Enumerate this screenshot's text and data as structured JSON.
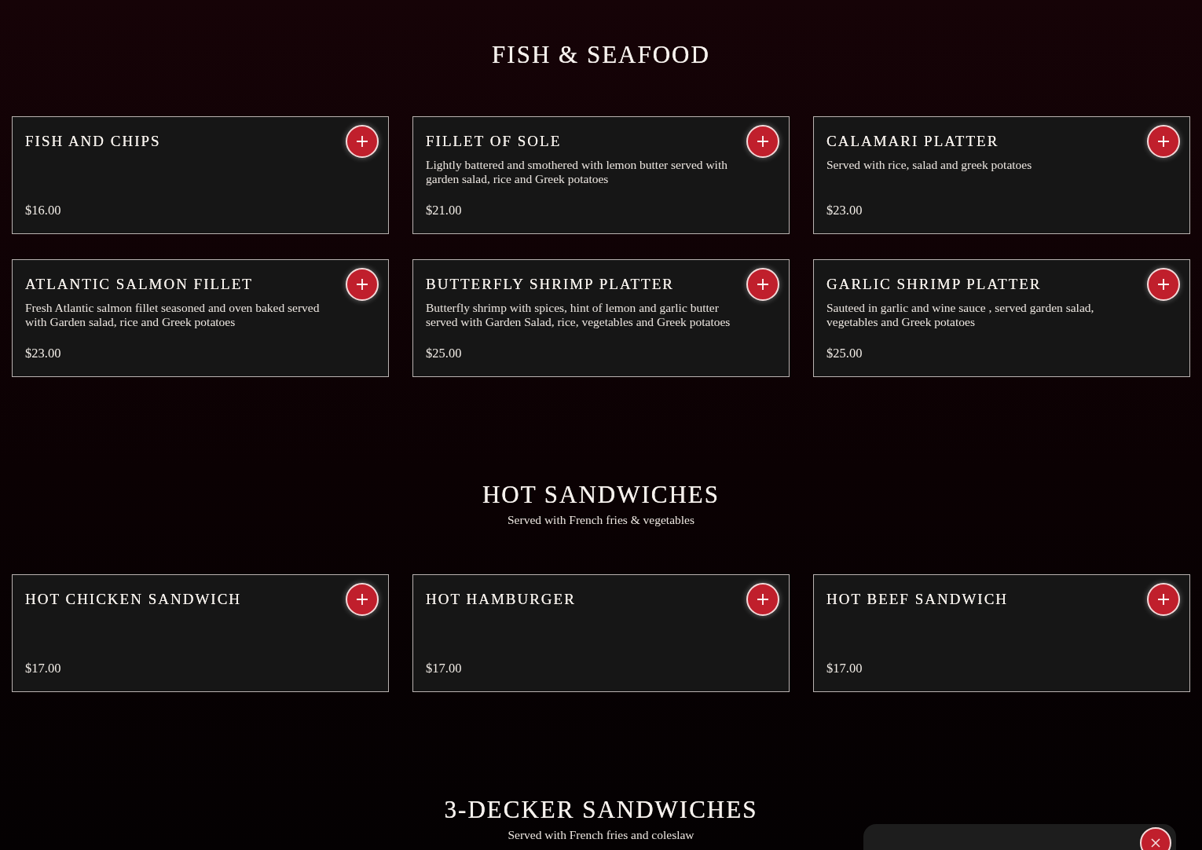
{
  "sections": [
    {
      "title": "FISH & SEAFOOD",
      "items": [
        {
          "name": "FISH AND CHIPS",
          "price": "$16.00"
        },
        {
          "name": "FILLET OF SOLE",
          "description": "Lightly battered and smothered with lemon butter served with garden salad, rice and Greek potatoes",
          "price": "$21.00"
        },
        {
          "name": "CALAMARI PLATTER",
          "description": "Served with rice, salad and greek potatoes",
          "price": "$23.00"
        },
        {
          "name": "ATLANTIC SALMON FILLET",
          "description": "Fresh Atlantic salmon fillet seasoned and oven baked served with Garden salad, rice and Greek potatoes",
          "price": "$23.00"
        },
        {
          "name": "BUTTERFLY SHRIMP PLATTER",
          "description": "Butterfly shrimp with spices, hint of lemon and garlic butter served with Garden Salad, rice, vegetables and Greek potatoes",
          "price": "$25.00"
        },
        {
          "name": "GARLIC SHRIMP PLATTER",
          "description": "Sauteed in garlic and wine sauce , served garden salad, vegetables and Greek potatoes",
          "price": "$25.00"
        }
      ]
    },
    {
      "title": "HOT SANDWICHES",
      "subtitle": "Served with French fries & vegetables",
      "items": [
        {
          "name": "HOT CHICKEN SANDWICH",
          "price": "$17.00"
        },
        {
          "name": "HOT HAMBURGER",
          "price": "$17.00"
        },
        {
          "name": "HOT BEEF SANDWICH",
          "price": "$17.00"
        }
      ]
    },
    {
      "title": "3-DECKER SANDWICHES",
      "subtitle": "Served with French fries and coleslaw"
    }
  ]
}
